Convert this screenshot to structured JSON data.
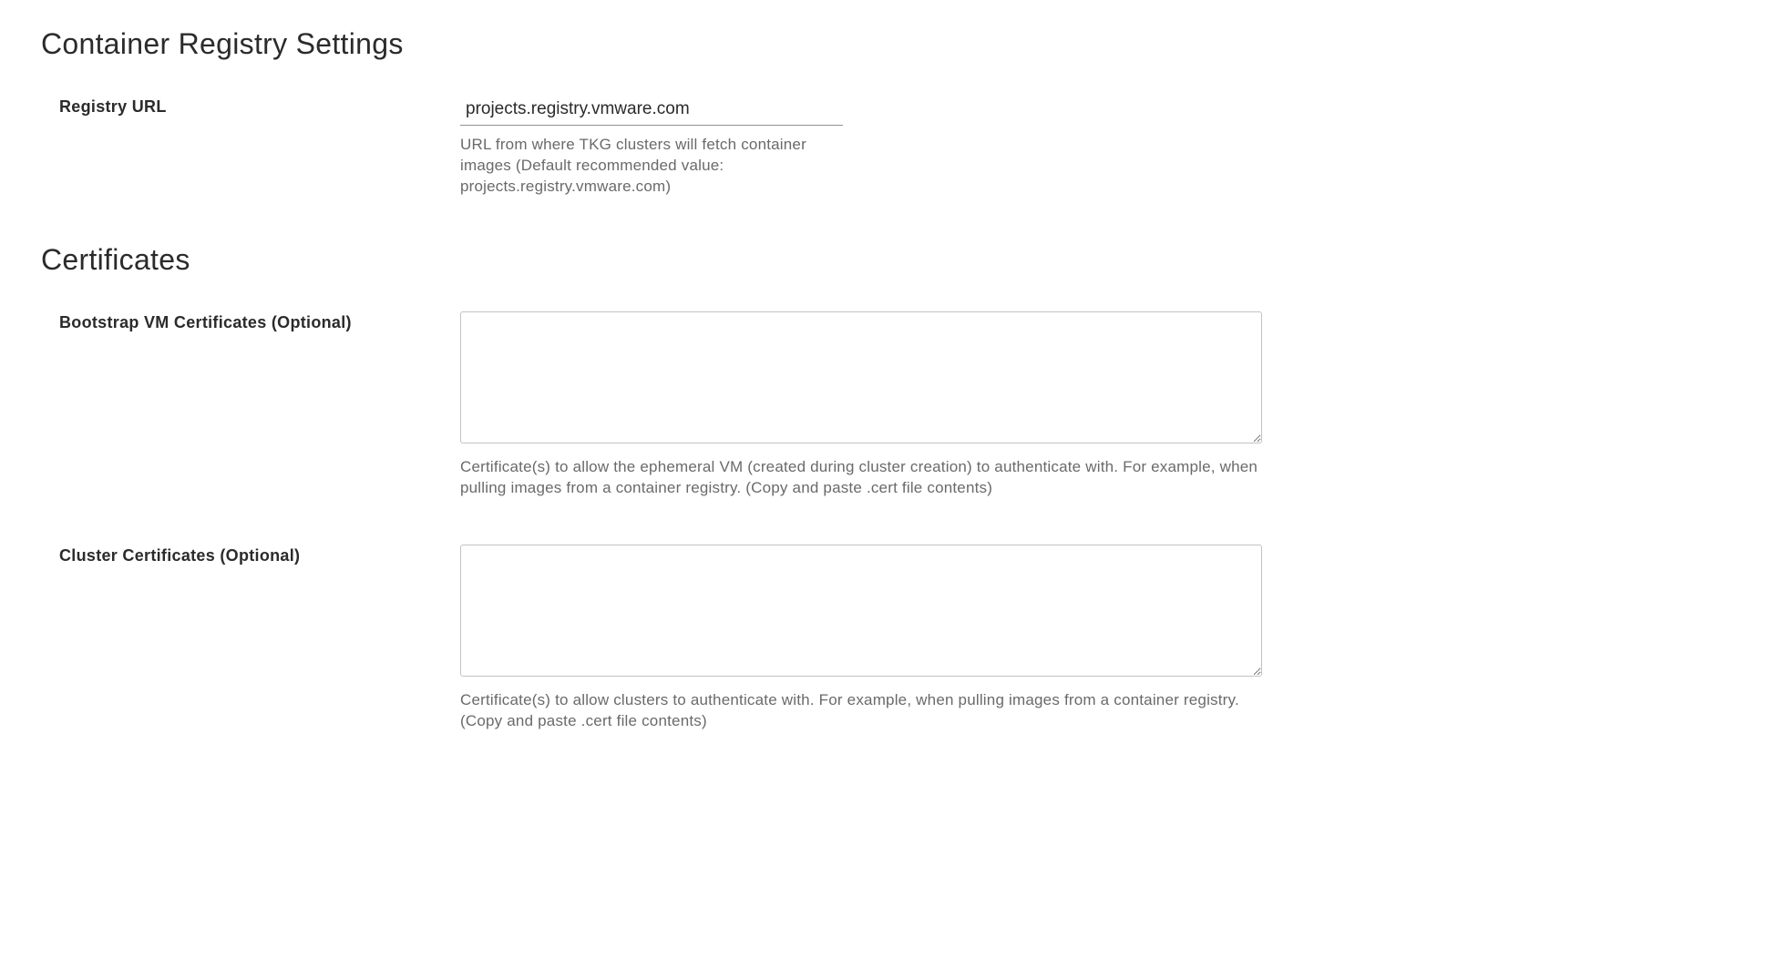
{
  "registrySection": {
    "heading": "Container Registry Settings",
    "registryUrl": {
      "label": "Registry URL",
      "value": "projects.registry.vmware.com",
      "help": "URL from where TKG clusters will fetch container images (Default recommended value: projects.registry.vmware.com)"
    }
  },
  "certificatesSection": {
    "heading": "Certificates",
    "bootstrapCerts": {
      "label": "Bootstrap VM Certificates (Optional)",
      "value": "",
      "help": "Certificate(s) to allow the ephemeral VM (created during cluster creation) to authenticate with. For example, when pulling images from a container registry. (Copy and paste .cert file contents)"
    },
    "clusterCerts": {
      "label": "Cluster Certificates (Optional)",
      "value": "",
      "help": "Certificate(s) to allow clusters to authenticate with. For example, when pulling images from a container registry. (Copy and paste .cert file contents)"
    }
  }
}
